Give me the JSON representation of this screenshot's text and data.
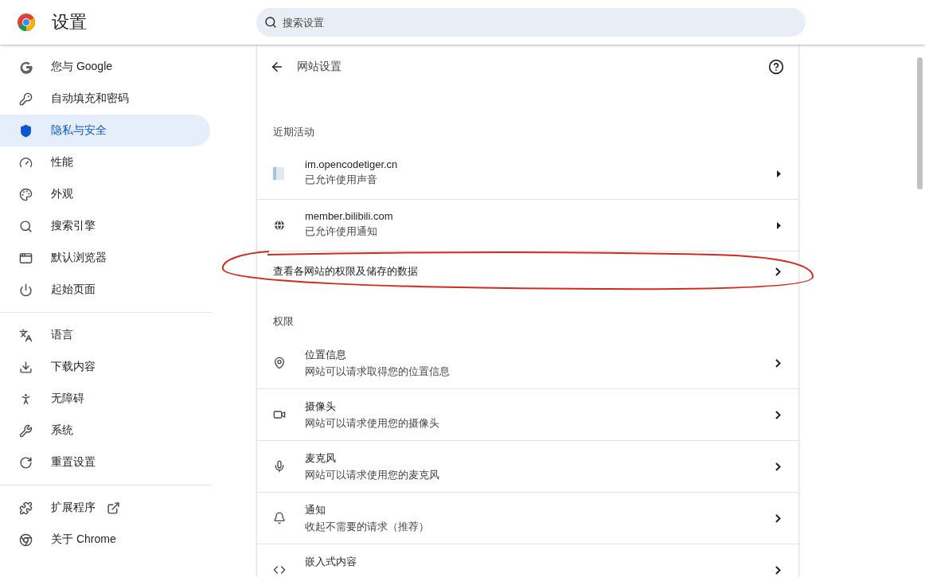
{
  "header": {
    "title": "设置",
    "search": {
      "placeholder": "搜索设置"
    }
  },
  "sidebar": {
    "groups": [
      [
        {
          "label": "您与 Google",
          "selected": false,
          "external": false
        },
        {
          "label": "自动填充和密码",
          "selected": false,
          "external": false
        },
        {
          "label": "隐私与安全",
          "selected": true,
          "external": false
        },
        {
          "label": "性能",
          "selected": false,
          "external": false
        },
        {
          "label": "外观",
          "selected": false,
          "external": false
        },
        {
          "label": "搜索引擎",
          "selected": false,
          "external": false
        },
        {
          "label": "默认浏览器",
          "selected": false,
          "external": false
        },
        {
          "label": "起始页面",
          "selected": false,
          "external": false
        }
      ],
      [
        {
          "label": "语言",
          "selected": false,
          "external": false
        },
        {
          "label": "下载内容",
          "selected": false,
          "external": false
        },
        {
          "label": "无障碍",
          "selected": false,
          "external": false
        },
        {
          "label": "系统",
          "selected": false,
          "external": false
        },
        {
          "label": "重置设置",
          "selected": false,
          "external": false
        }
      ],
      [
        {
          "label": "扩展程序",
          "selected": false,
          "external": true
        },
        {
          "label": "关于 Chrome",
          "selected": false,
          "external": false
        }
      ]
    ]
  },
  "page": {
    "title": "网站设置",
    "sections": [
      {
        "heading": "近期活动",
        "rows": [
          {
            "kind": "site",
            "title": "im.opencodetiger.cn",
            "description": "已允许使用声音"
          },
          {
            "kind": "site",
            "title": "member.bilibili.com",
            "description": "已允许使用通知"
          },
          {
            "kind": "link",
            "title": "查看各网站的权限及储存的数据"
          }
        ]
      },
      {
        "heading": "权限",
        "rows": [
          {
            "kind": "permission",
            "title": "位置信息",
            "description": "网站可以请求取得您的位置信息"
          },
          {
            "kind": "permission",
            "title": "摄像头",
            "description": "网站可以请求使用您的摄像头"
          },
          {
            "kind": "permission",
            "title": "麦克风",
            "description": "网站可以请求使用您的麦克风"
          },
          {
            "kind": "permission",
            "title": "通知",
            "description": "收起不需要的请求（推荐）"
          },
          {
            "kind": "permission",
            "title": "嵌入式内容"
          }
        ]
      }
    ]
  }
}
